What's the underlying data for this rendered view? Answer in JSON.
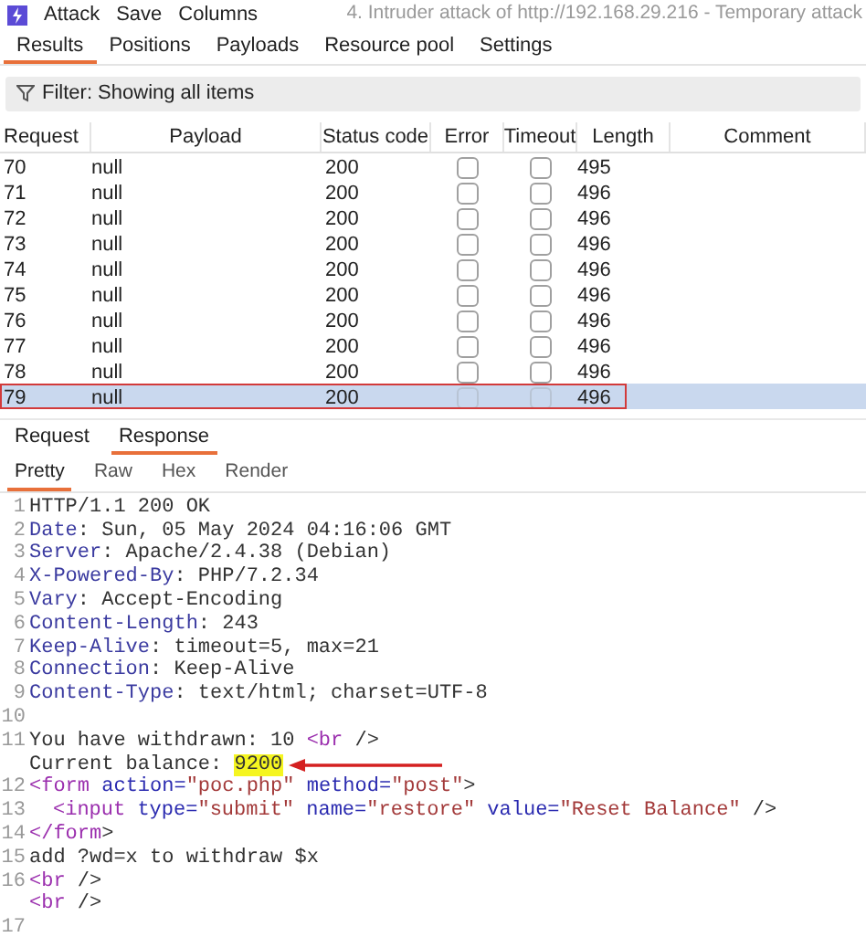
{
  "menu": [
    "Attack",
    "Save",
    "Columns"
  ],
  "window": {
    "title": "4. Intruder attack of http://192.168.29.216 - Temporary attack"
  },
  "tabs": [
    {
      "label": "Results",
      "selected": true
    },
    {
      "label": "Positions",
      "selected": false
    },
    {
      "label": "Payloads",
      "selected": false
    },
    {
      "label": "Resource pool",
      "selected": false
    },
    {
      "label": "Settings",
      "selected": false
    }
  ],
  "filter": "Filter: Showing all items",
  "table": {
    "columns": [
      "Request",
      "Payload",
      "Status code",
      "Error",
      "Timeout",
      "Length",
      "Comment"
    ],
    "rows": [
      {
        "request": "70",
        "payload": "null",
        "status": "200",
        "error": false,
        "timeout": false,
        "length": "495",
        "selected": false,
        "outlined": false
      },
      {
        "request": "71",
        "payload": "null",
        "status": "200",
        "error": false,
        "timeout": false,
        "length": "496",
        "selected": false,
        "outlined": false
      },
      {
        "request": "72",
        "payload": "null",
        "status": "200",
        "error": false,
        "timeout": false,
        "length": "496",
        "selected": false,
        "outlined": false
      },
      {
        "request": "73",
        "payload": "null",
        "status": "200",
        "error": false,
        "timeout": false,
        "length": "496",
        "selected": false,
        "outlined": false
      },
      {
        "request": "74",
        "payload": "null",
        "status": "200",
        "error": false,
        "timeout": false,
        "length": "496",
        "selected": false,
        "outlined": false
      },
      {
        "request": "75",
        "payload": "null",
        "status": "200",
        "error": false,
        "timeout": false,
        "length": "496",
        "selected": false,
        "outlined": false
      },
      {
        "request": "76",
        "payload": "null",
        "status": "200",
        "error": false,
        "timeout": false,
        "length": "496",
        "selected": false,
        "outlined": false
      },
      {
        "request": "77",
        "payload": "null",
        "status": "200",
        "error": false,
        "timeout": false,
        "length": "496",
        "selected": false,
        "outlined": false
      },
      {
        "request": "78",
        "payload": "null",
        "status": "200",
        "error": false,
        "timeout": false,
        "length": "496",
        "selected": false,
        "outlined": false
      },
      {
        "request": "79",
        "payload": "null",
        "status": "200",
        "error": false,
        "timeout": false,
        "length": "496",
        "selected": true,
        "outlined": true
      }
    ]
  },
  "message_tabs": [
    {
      "label": "Request",
      "selected": false
    },
    {
      "label": "Response",
      "selected": true
    }
  ],
  "view_tabs": [
    {
      "label": "Pretty",
      "selected": true
    },
    {
      "label": "Raw",
      "selected": false
    },
    {
      "label": "Hex",
      "selected": false
    },
    {
      "label": "Render",
      "selected": false
    }
  ],
  "code": [
    {
      "number": "1",
      "tokens": [
        {
          "kind": "plain",
          "text": "HTTP/1.1 200 OK"
        }
      ]
    },
    {
      "number": "2",
      "tokens": [
        {
          "kind": "key",
          "text": "Date"
        },
        {
          "kind": "plain",
          "text": ": Sun, 05 May 2024 04:16:06 GMT"
        }
      ]
    },
    {
      "number": "3",
      "tokens": [
        {
          "kind": "key",
          "text": "Server"
        },
        {
          "kind": "plain",
          "text": ": Apache/2.4.38 (Debian)"
        }
      ]
    },
    {
      "number": "4",
      "tokens": [
        {
          "kind": "key",
          "text": "X-Powered-By"
        },
        {
          "kind": "plain",
          "text": ": PHP/7.2.34"
        }
      ]
    },
    {
      "number": "5",
      "tokens": [
        {
          "kind": "key",
          "text": "Vary"
        },
        {
          "kind": "plain",
          "text": ": Accept-Encoding"
        }
      ]
    },
    {
      "number": "6",
      "tokens": [
        {
          "kind": "key",
          "text": "Content-Length"
        },
        {
          "kind": "plain",
          "text": ": 243"
        }
      ]
    },
    {
      "number": "7",
      "tokens": [
        {
          "kind": "key",
          "text": "Keep-Alive"
        },
        {
          "kind": "plain",
          "text": ": timeout=5, max=21"
        }
      ]
    },
    {
      "number": "8",
      "tokens": [
        {
          "kind": "key",
          "text": "Connection"
        },
        {
          "kind": "plain",
          "text": ": Keep-Alive"
        }
      ]
    },
    {
      "number": "9",
      "tokens": [
        {
          "kind": "key",
          "text": "Content-Type"
        },
        {
          "kind": "plain",
          "text": ": text/html; charset=UTF-8"
        }
      ]
    },
    {
      "number": "10"
    },
    {
      "number": "11",
      "tokens": [
        {
          "kind": "plain",
          "text": "You have withdrawn: 10 "
        },
        {
          "kind": "tag",
          "text": "<br"
        },
        {
          "kind": "plain",
          "text": " />"
        }
      ]
    },
    {
      "tokens": [
        {
          "kind": "plain",
          "text": "Current balance: "
        },
        {
          "kind": "mark",
          "text": "9200"
        }
      ],
      "arrow": true
    },
    {
      "number": "12",
      "tokens": [
        {
          "kind": "tag",
          "text": "<form"
        },
        {
          "kind": "attr",
          "text": " action="
        },
        {
          "kind": "value",
          "text": "\"poc.php\""
        },
        {
          "kind": "attr",
          "text": " method="
        },
        {
          "kind": "value",
          "text": "\"post\""
        },
        {
          "kind": "plain",
          "text": ">"
        }
      ]
    },
    {
      "number": "13",
      "indented": true,
      "tokens": [
        {
          "kind": "tag",
          "text": "<input"
        },
        {
          "kind": "attr",
          "text": " type="
        },
        {
          "kind": "value",
          "text": "\"submit\""
        },
        {
          "kind": "attr",
          "text": " name="
        },
        {
          "kind": "value",
          "text": "\"restore\""
        },
        {
          "kind": "attr",
          "text": " value="
        },
        {
          "kind": "value",
          "text": "\"Reset Balance\""
        },
        {
          "kind": "plain",
          "text": " />"
        }
      ]
    },
    {
      "number": "14",
      "tokens": [
        {
          "kind": "tag",
          "text": "</form"
        },
        {
          "kind": "plain",
          "text": ">"
        }
      ]
    },
    {
      "number": "15",
      "tokens": [
        {
          "kind": "plain",
          "text": "add ?wd=x to withdraw $x"
        }
      ]
    },
    {
      "number": "16",
      "tokens": [
        {
          "kind": "tag",
          "text": "<br"
        },
        {
          "kind": "plain",
          "text": " />"
        }
      ]
    },
    {
      "tokens": [
        {
          "kind": "tag",
          "text": "<br"
        },
        {
          "kind": "plain",
          "text": " />"
        }
      ]
    },
    {
      "number": "17"
    }
  ]
}
